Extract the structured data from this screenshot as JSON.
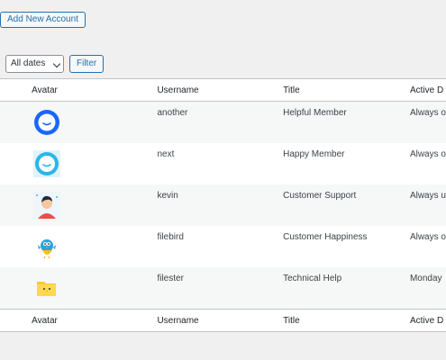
{
  "toolbar": {
    "add_new_label": "Add New Account",
    "date_filter_value": "All dates",
    "filter_label": "Filter"
  },
  "table": {
    "columns": [
      "Avatar",
      "Username",
      "Title",
      "Active D"
    ],
    "rows": [
      {
        "avatar_icon": "blue-chat-bubble-avatar",
        "username": "another",
        "title": "Helpful Member",
        "active": "Always o"
      },
      {
        "avatar_icon": "cyan-chat-bubble-avatar",
        "username": "next",
        "title": "Happy Member",
        "active": "Always o"
      },
      {
        "avatar_icon": "person-avatar",
        "username": "kevin",
        "title": "Customer Support",
        "active": "Always u"
      },
      {
        "avatar_icon": "bird-mascot-avatar",
        "username": "filebird",
        "title": "Customer Happiness",
        "active": "Always o"
      },
      {
        "avatar_icon": "yellow-folder-avatar",
        "username": "filester",
        "title": "Technical Help",
        "active": "Monday"
      }
    ]
  },
  "colors": {
    "accent": "#2271b1",
    "page_bg": "#f0f0f1",
    "row_alt": "#f6f7f7"
  }
}
